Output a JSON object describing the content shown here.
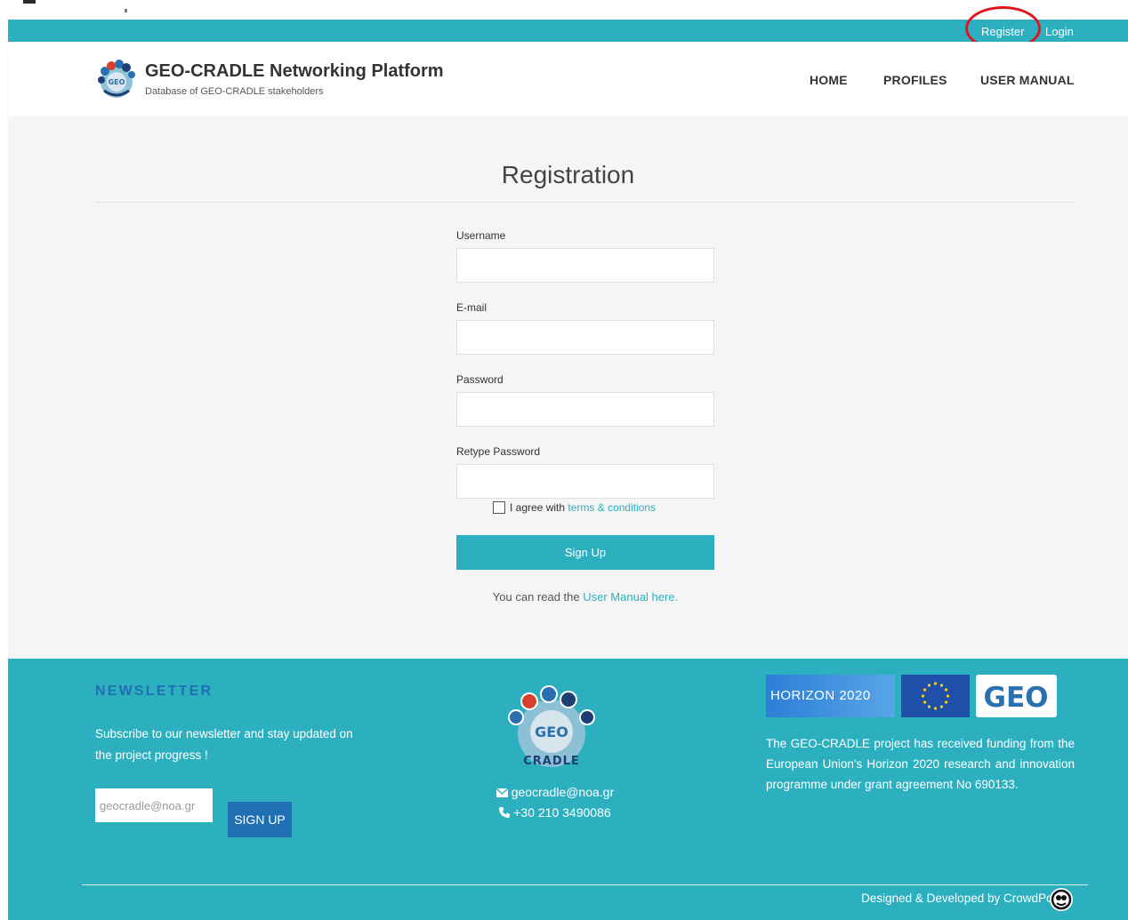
{
  "topbar": {
    "register": "Register",
    "login": "Login"
  },
  "header": {
    "title": "GEO-CRADLE Networking Platform",
    "subtitle": "Database of GEO-CRADLE stakeholders",
    "nav": [
      "HOME",
      "PROFILES",
      "USER MANUAL"
    ]
  },
  "main": {
    "title": "Registration",
    "fields": {
      "username": {
        "label": "Username",
        "value": ""
      },
      "email": {
        "label": "E-mail",
        "value": ""
      },
      "password": {
        "label": "Password",
        "value": ""
      },
      "retype": {
        "label": "Retype Password",
        "value": ""
      }
    },
    "agree_text": "I agree with",
    "terms_link": "terms & conditions",
    "agree_checked": false,
    "signup_button": "Sign Up",
    "manual_prefix": "You can read the",
    "manual_link": "User Manual here."
  },
  "footer": {
    "newsletter_title": "NEWSLETTER",
    "newsletter_text": "Subscribe to our newsletter and stay updated on the project progress !",
    "newsletter_placeholder": "geocradle@noa.gr",
    "newsletter_button": "SIGN UP",
    "logo_text": "CRADLE",
    "email": "geocradle@noa.gr",
    "phone": "+30 210 3490086",
    "horizon_label": "HORIZON 2020",
    "geo_label": "GEO",
    "funding_text": "The GEO-CRADLE project has received funding from the European Union's Horizon 2020 research and innovation programme under grant agreement No 690133.",
    "credits": "Designed & Developed by CrowdPolicy"
  },
  "colors": {
    "teal": "#2cb0bf",
    "navy": "#1f6fb2",
    "highlight": "#e0141c"
  },
  "icons": [
    "envelope-icon",
    "phone-icon",
    "checkbox-icon",
    "crowdpolicy-icon",
    "eu-flag-icon"
  ]
}
